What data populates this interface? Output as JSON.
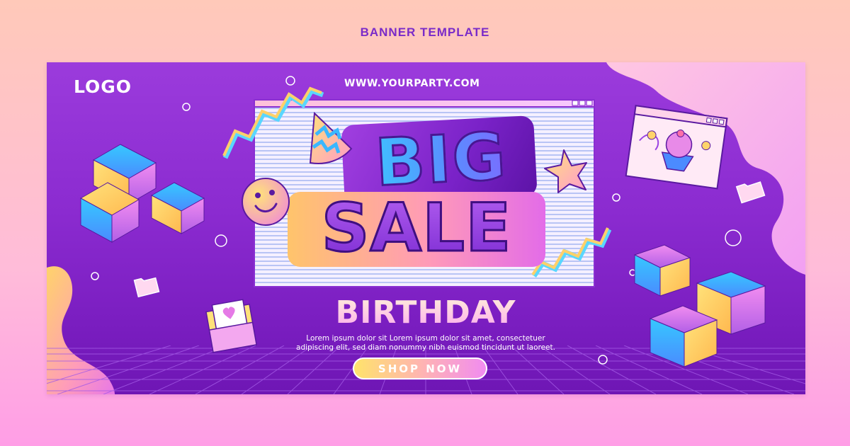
{
  "page": {
    "heading": "BANNER TEMPLATE"
  },
  "banner": {
    "logo": "LOGO",
    "url": "WWW.YOURPARTY.COM",
    "headline_top": "BIG",
    "headline_bottom": "SALE",
    "subtitle": "BIRTHDAY",
    "body_text_line1": "Lorem ipsum dolor sit Lorem ipsum dolor sit amet, consectetuer",
    "body_text_line2": "adipiscing elit, sed diam nonummy nibh euismod tincidunt ut laoreet.",
    "cta_label": "SHOP NOW"
  },
  "colors": {
    "page_background": "#ffc9b9",
    "banner_purple": "#8b2bd0",
    "heading_purple": "#7a2bc9",
    "accent_yellow": "#ffe36b",
    "accent_pink": "#f18cf0",
    "accent_cyan": "#35d3ff"
  },
  "icons": [
    "cube-icon",
    "smiley-icon",
    "party-hat-icon",
    "star-icon",
    "cupcake-window-icon",
    "folder-icon",
    "envelope-heart-icon",
    "zigzag-icon",
    "ring-icon"
  ]
}
